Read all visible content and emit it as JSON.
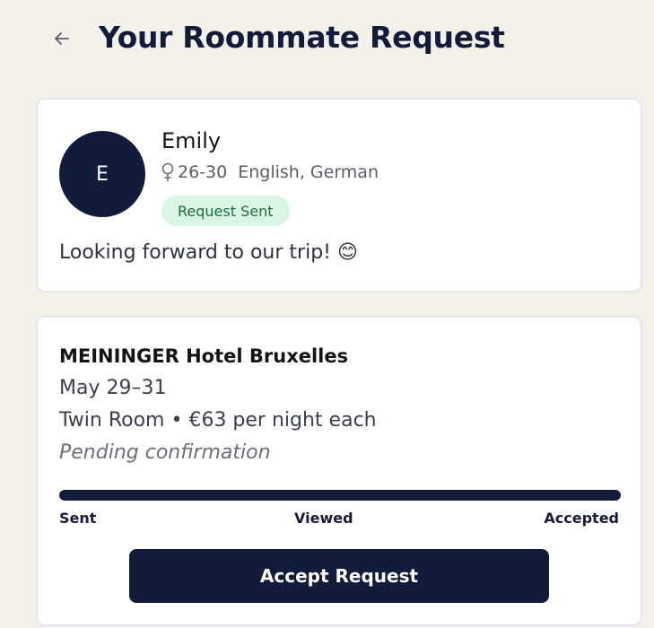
{
  "header": {
    "back_icon": "arrow-left-icon",
    "title": "Your Roommate Request"
  },
  "profile": {
    "initial": "E",
    "name": "Emily",
    "gender_icon": "female-symbol-icon",
    "age_range": "26-30",
    "languages": "English, German",
    "status": "Request Sent",
    "message": "Looking forward to our trip! 😊"
  },
  "booking": {
    "hotel": "MEININGER Hotel Bruxelles",
    "dates": "May 29–31",
    "room": "Twin Room • €63 per night each",
    "status_note": "Pending confirmation",
    "progress": 1.0,
    "steps": [
      "Sent",
      "Viewed",
      "Accepted"
    ],
    "action_label": "Accept Request"
  },
  "colors": {
    "background": "#f4f1ea",
    "primary": "#131b3b",
    "badge_bg": "#daf5e3",
    "badge_text": "#1e6b3a"
  }
}
